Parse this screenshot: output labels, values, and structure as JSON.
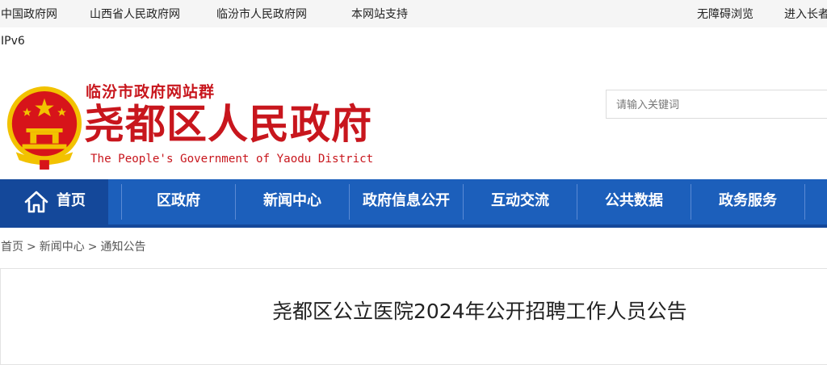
{
  "topbar": {
    "links": [
      "中国政府网",
      "山西省人民政府网",
      "临汾市人民政府网",
      "本网站支持"
    ],
    "right_links": [
      "无障碍浏览",
      "进入长者"
    ]
  },
  "ipv6_label": "IPv6",
  "header": {
    "site_group": "临汾市政府网站群",
    "title": "尧都区人民政府",
    "title_en": "The People's Government of Yaodu District"
  },
  "search": {
    "placeholder": "请输入关键词",
    "value": ""
  },
  "nav": {
    "items": [
      "首页",
      "区政府",
      "新闻中心",
      "政府信息公开",
      "互动交流",
      "公共数据",
      "政务服务"
    ],
    "active_index": 0
  },
  "breadcrumb": [
    "首页",
    "新闻中心",
    "通知公告"
  ],
  "breadcrumb_separator": ">",
  "article": {
    "title": "尧都区公立医院2024年公开招聘工作人员公告"
  },
  "colors": {
    "brand_red": "#c8161d",
    "nav_blue": "#1c5fbb",
    "nav_active": "#14489a",
    "emblem_gold": "#f2c200"
  },
  "icons": {
    "home": "home-icon",
    "emblem": "national-emblem-icon"
  }
}
